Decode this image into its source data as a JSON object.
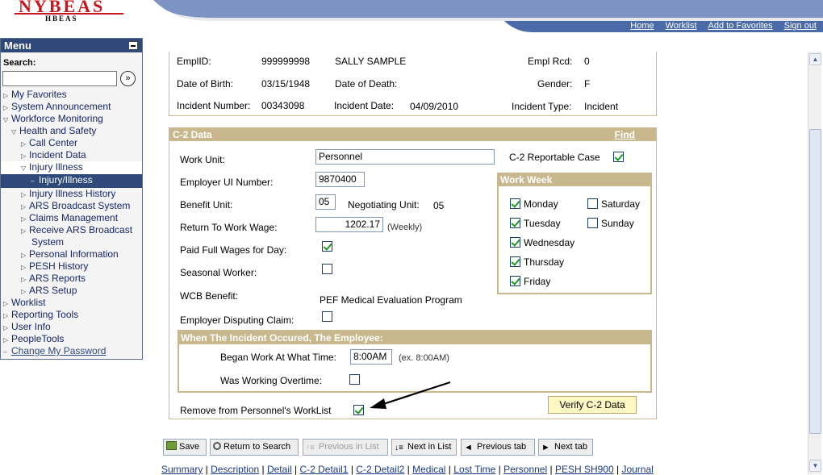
{
  "header": {
    "logo_main": "NYBEAS",
    "logo_sub": "HBEAS",
    "nav": [
      "Home",
      "Worklist",
      "Add to Favorites",
      "Sign out"
    ]
  },
  "menu": {
    "title": "Menu",
    "search_label": "Search:",
    "search_value": "",
    "items": [
      {
        "label": "My Favorites",
        "icon": "triangle-right-icon"
      },
      {
        "label": "System Announcement",
        "icon": "triangle-right-icon"
      },
      {
        "label": "Workforce Monitoring",
        "icon": "triangle-down-icon"
      },
      {
        "label": "Health and Safety",
        "icon": "triangle-down-icon"
      },
      {
        "label": "Call Center",
        "icon": "triangle-right-icon"
      },
      {
        "label": "Incident Data",
        "icon": "triangle-right-icon"
      },
      {
        "label": "Injury Illness",
        "icon": "triangle-down-icon"
      },
      {
        "label": "Injury/Illness",
        "icon": "dash-icon"
      },
      {
        "label": "Injury Illness History",
        "icon": "triangle-right-icon"
      },
      {
        "label": "ARS Broadcast System",
        "icon": "triangle-right-icon"
      },
      {
        "label": "Claims Management",
        "icon": "triangle-right-icon"
      },
      {
        "label": "Receive ARS Broadcast",
        "icon": "triangle-right-icon"
      },
      {
        "label": "System",
        "icon": ""
      },
      {
        "label": "Personal Information",
        "icon": "triangle-right-icon"
      },
      {
        "label": "PESH History",
        "icon": "triangle-right-icon"
      },
      {
        "label": "ARS Reports",
        "icon": "triangle-right-icon"
      },
      {
        "label": "ARS Setup",
        "icon": "triangle-right-icon"
      },
      {
        "label": "Worklist",
        "icon": "triangle-right-icon"
      },
      {
        "label": "Reporting Tools",
        "icon": "triangle-right-icon"
      },
      {
        "label": "User Info",
        "icon": "triangle-right-icon"
      },
      {
        "label": "PeopleTools",
        "icon": "triangle-right-icon"
      },
      {
        "label": "Change My Password",
        "icon": "dash-icon"
      }
    ]
  },
  "employee": {
    "emplid_label": "EmplID:",
    "emplid": "999999998",
    "name": "SALLY SAMPLE",
    "empl_rcd_label": "Empl Rcd:",
    "empl_rcd": "0",
    "dob_label": "Date of Birth:",
    "dob": "03/15/1948",
    "dod_label": "Date of Death:",
    "dod": "",
    "gender_label": "Gender:",
    "gender": "F",
    "incident_number_label": "Incident Number:",
    "incident_number": "00343098",
    "incident_date_label": "Incident Date:",
    "incident_date": "04/09/2010",
    "incident_type_label": "Incident Type:",
    "incident_type": "Incident"
  },
  "c2": {
    "title": "C-2 Data",
    "find": "Find",
    "work_unit_label": "Work Unit:",
    "work_unit": "Personnel",
    "reportable_label": "C-2 Reportable Case",
    "reportable": true,
    "employer_ui_label": "Employer UI Number:",
    "employer_ui": "9870400",
    "benefit_unit_label": "Benefit Unit:",
    "benefit_unit": "05",
    "negotiating_unit_label": "Negotiating Unit:",
    "negotiating_unit": "05",
    "rtw_wage_label": "Return To Work Wage:",
    "rtw_wage": "1202.17",
    "rtw_wage_unit": "(Weekly)",
    "paid_full_label": "Paid Full Wages for Day:",
    "paid_full": true,
    "seasonal_label": "Seasonal Worker:",
    "seasonal": false,
    "wcb_label": "WCB Benefit:",
    "wcb": "PEF Medical Evaluation Program",
    "disputing_label": "Employer Disputing Claim:",
    "disputing": false,
    "work_week_title": "Work Week",
    "days": [
      {
        "label": "Monday",
        "checked": true
      },
      {
        "label": "Tuesday",
        "checked": true
      },
      {
        "label": "Wednesday",
        "checked": true
      },
      {
        "label": "Thursday",
        "checked": true
      },
      {
        "label": "Friday",
        "checked": true
      },
      {
        "label": "Saturday",
        "checked": false
      },
      {
        "label": "Sunday",
        "checked": false
      }
    ],
    "when_title": "When The Incident Occured, The Employee:",
    "began_label": "Began Work At What Time:",
    "began_value": "8:00AM",
    "began_hint": "(ex. 8:00AM)",
    "overtime_label": "Was Working Overtime:",
    "overtime": false,
    "remove_label": "Remove from Personnel's WorkList",
    "remove": true,
    "verify_label": "Verify C-2 Data"
  },
  "toolbar": {
    "save": "Save",
    "return_search": "Return to Search",
    "prev_list": "Previous in List",
    "next_list": "Next in List",
    "prev_tab": "Previous tab",
    "next_tab": "Next tab"
  },
  "page_links": [
    "Summary",
    "Description",
    "Detail",
    "C-2 Detail1",
    "C-2 Detail2",
    "Medical",
    "Lost Time",
    "Personnel",
    "PESH SH900",
    "Journal"
  ],
  "colors": {
    "accent": "#2f4a7a",
    "section": "#c9b78d",
    "check": "#1f9a1f",
    "logo": "#c8161d"
  }
}
